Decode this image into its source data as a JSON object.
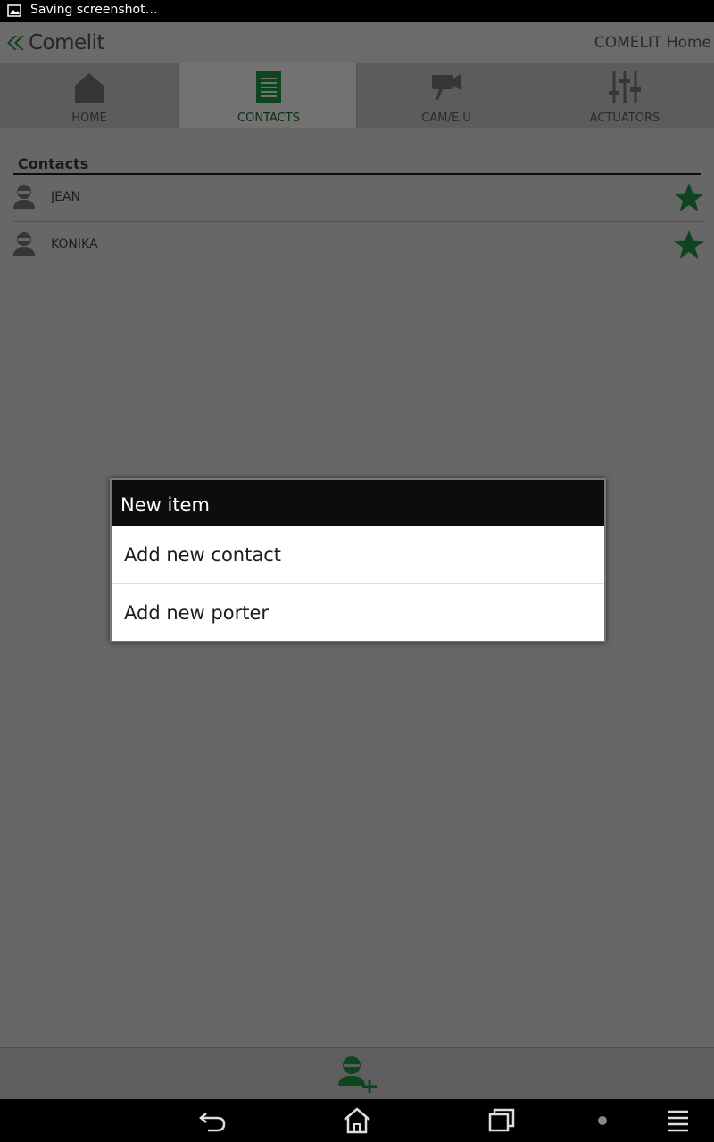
{
  "status_bar": {
    "text": "Saving screenshot…"
  },
  "app_bar": {
    "logo_text": "Comelit",
    "title": "COMELIT Home"
  },
  "tabs": [
    {
      "label": "HOME",
      "icon": "home-icon"
    },
    {
      "label": "CONTACTS",
      "icon": "contacts-list-icon",
      "active": true
    },
    {
      "label": "CAM/E.U",
      "icon": "camera-icon"
    },
    {
      "label": "ACTUATORS",
      "icon": "sliders-icon"
    }
  ],
  "contacts": {
    "section_title": "Contacts",
    "items": [
      {
        "name": "JEAN",
        "favorite": true
      },
      {
        "name": "KONIKA",
        "favorite": true
      }
    ]
  },
  "dialog": {
    "title": "New item",
    "options": [
      "Add new contact",
      "Add new porter"
    ]
  },
  "bottom_bar": {
    "action_icon": "add-contact-icon"
  },
  "nav_bar": {
    "buttons": [
      "back-icon",
      "home-icon",
      "recent-apps-icon",
      "dot-icon",
      "menu-icon"
    ]
  },
  "colors": {
    "brand_green": "#1f8a3c",
    "active_tab_text": "#1d5a2b",
    "overlay": "rgba(0,0,0,0.5)"
  }
}
